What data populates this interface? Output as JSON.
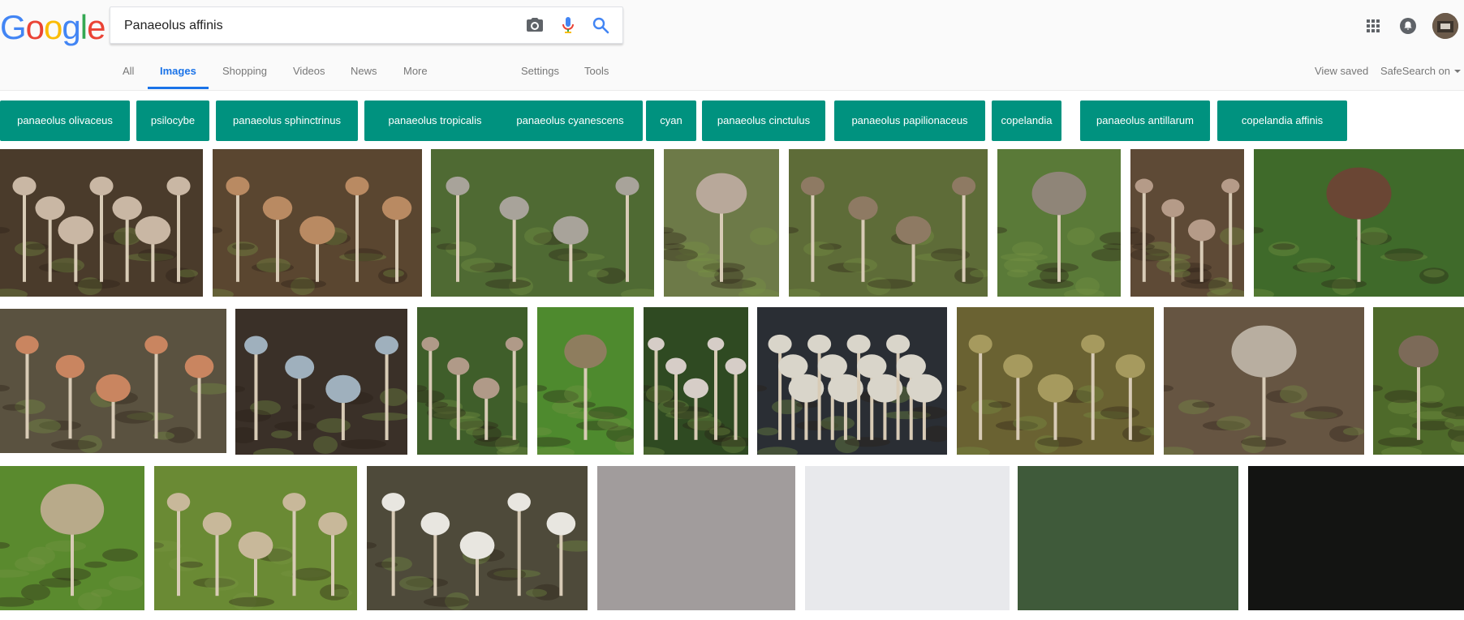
{
  "search": {
    "query": "Panaeolus affinis"
  },
  "logo": [
    "G",
    "o",
    "o",
    "g",
    "l",
    "e"
  ],
  "logo_colors": [
    "#4285f4",
    "#ea4335",
    "#fbbc05",
    "#4285f4",
    "#34a853",
    "#ea4335"
  ],
  "tabs": [
    {
      "label": "All"
    },
    {
      "label": "Images"
    },
    {
      "label": "Shopping"
    },
    {
      "label": "Videos"
    },
    {
      "label": "News"
    },
    {
      "label": "More"
    },
    {
      "label": "Settings"
    },
    {
      "label": "Tools"
    }
  ],
  "right_links": {
    "view_saved": "View saved",
    "safesearch": "SafeSearch on"
  },
  "chips": [
    "panaeolus olivaceus",
    "psilocybe",
    "panaeolus sphinctrinus",
    "panaeolus tropicalis",
    "panaeolus cyanescens",
    "cyan",
    "panaeolus cinctulus",
    "panaeolus papilionaceus",
    "copelandia",
    "panaeolus antillarum",
    "copelandia affinis"
  ],
  "icons": {
    "camera": "camera-icon",
    "mic": "mic-icon",
    "search": "search-icon",
    "apps": "apps-grid-icon",
    "notifications": "notifications-icon"
  },
  "colors": {
    "accent": "#1a73e8",
    "chip_bg": "#00927f"
  },
  "image_tiles": [
    {
      "bg": "#4a3b2b",
      "cap": "#c9b7a4",
      "kind": "forest"
    },
    {
      "bg": "#5a4630",
      "cap": "#b98a62",
      "kind": "cluster"
    },
    {
      "bg": "#4f6a33",
      "cap": "#a8a39a",
      "kind": "grass"
    },
    {
      "bg": "#6d7a48",
      "cap": "#b8a89a",
      "kind": "single"
    },
    {
      "bg": "#5e6c38",
      "cap": "#8e7a63",
      "kind": "tall"
    },
    {
      "bg": "#5a7a38",
      "cap": "#8f8578",
      "kind": "single"
    },
    {
      "bg": "#5e4a36",
      "cap": "#b59b88",
      "kind": "tall"
    },
    {
      "bg": "#3f6a2a",
      "cap": "#6a4634",
      "kind": "toad"
    },
    {
      "bg": "#5a5240",
      "cap": "#c98560",
      "kind": "cluster"
    },
    {
      "bg": "#3a3028",
      "cap": "#9fb0bd",
      "kind": "blue"
    },
    {
      "bg": "#3f5e2a",
      "cap": "#b09a88",
      "kind": "tall"
    },
    {
      "bg": "#4e8a2e",
      "cap": "#8e7d5e",
      "kind": "single"
    },
    {
      "bg": "#2f4a22",
      "cap": "#d6cdc7",
      "kind": "cluster"
    },
    {
      "bg": "#2a2e34",
      "cap": "#d9d5ca",
      "kind": "lab"
    },
    {
      "bg": "#6a6232",
      "cap": "#a69a5e",
      "kind": "cluster"
    },
    {
      "bg": "#665542",
      "cap": "#b8aea0",
      "kind": "single"
    },
    {
      "bg": "#4e6a2a",
      "cap": "#7c6a58",
      "kind": "single"
    },
    {
      "bg": "#5a8a2e",
      "cap": "#b8aa8a",
      "kind": "single"
    },
    {
      "bg": "#6a8a34",
      "cap": "#c8b89a",
      "kind": "cluster"
    },
    {
      "bg": "#4e4a3a",
      "cap": "#e8e6e0",
      "kind": "large"
    },
    {
      "bg": "#a19c9c",
      "cap": "",
      "kind": "flat"
    },
    {
      "bg": "#e8e9ec",
      "cap": "",
      "kind": "flat"
    },
    {
      "bg": "#3f5a3a",
      "cap": "",
      "kind": "flat"
    },
    {
      "bg": "#131412",
      "cap": "",
      "kind": "flat"
    }
  ]
}
